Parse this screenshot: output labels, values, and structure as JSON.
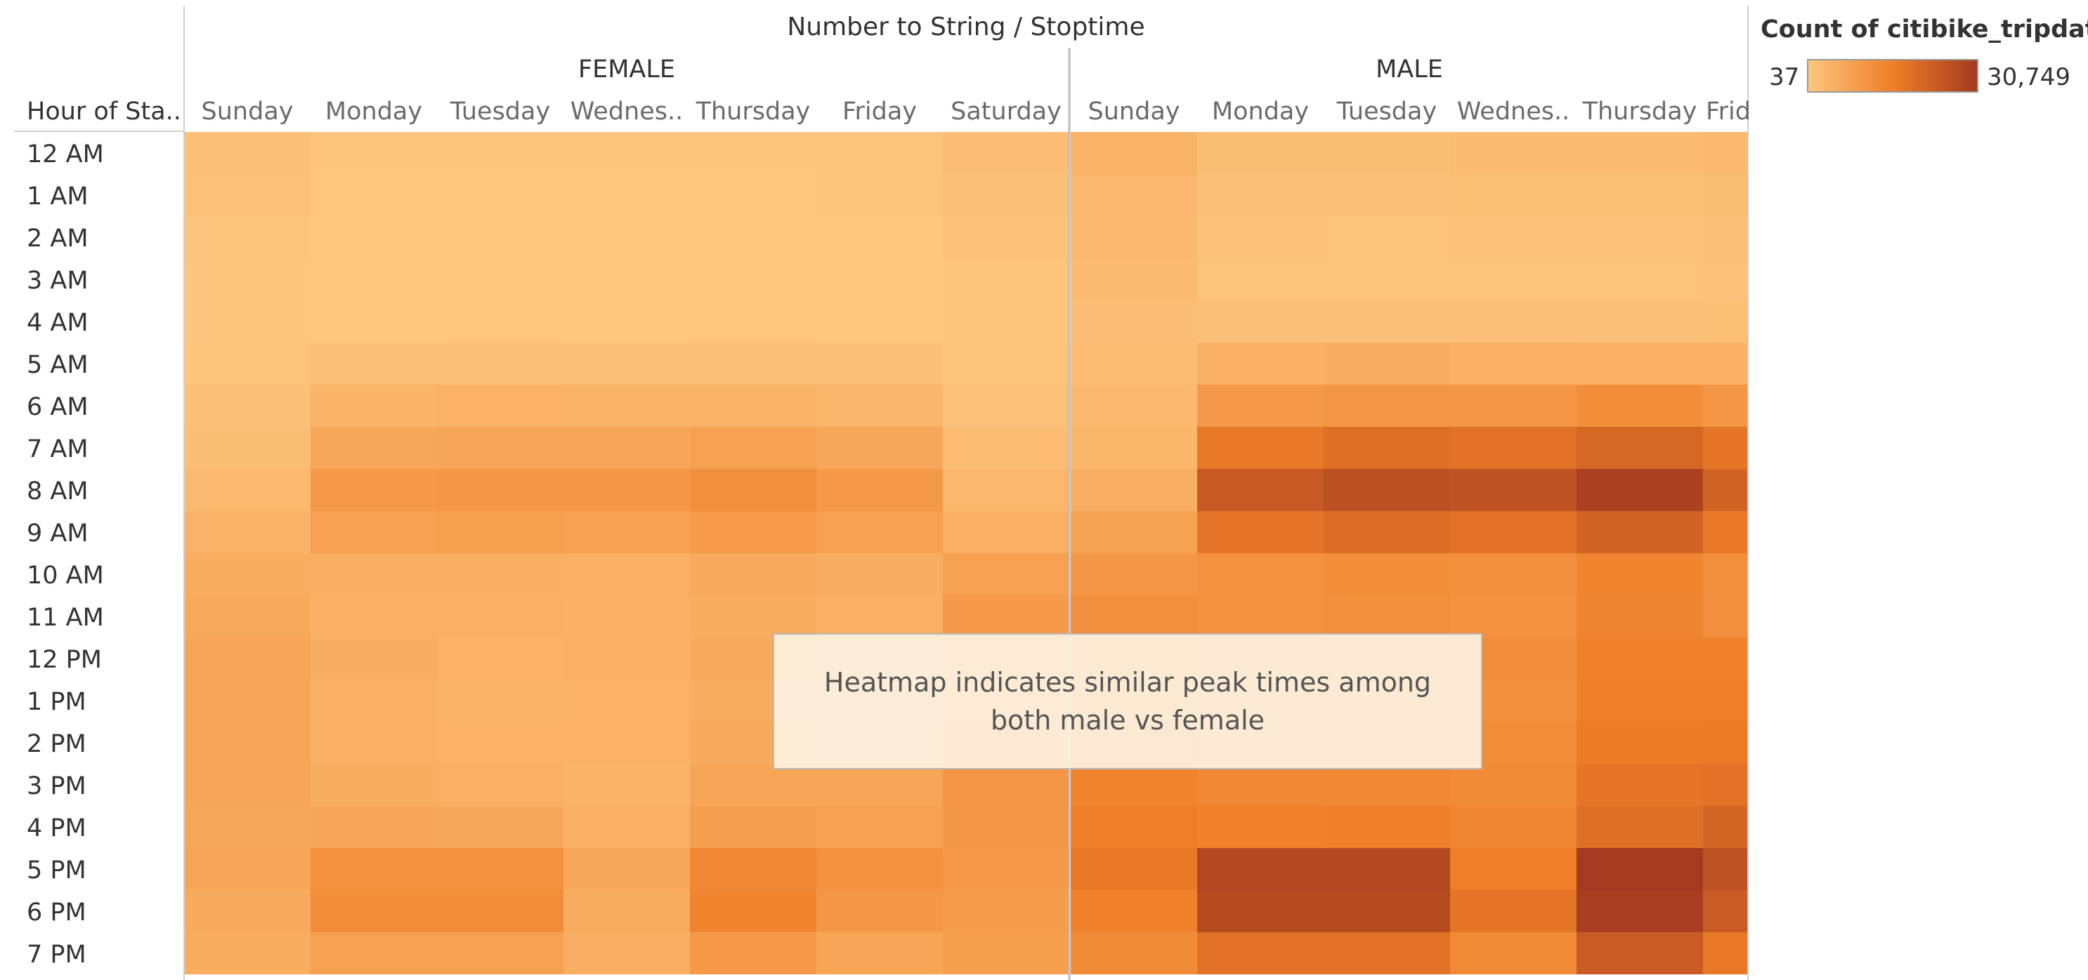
{
  "chart_data": {
    "type": "heatmap",
    "title": "Number to String / Stoptime",
    "row_header": "Hour of Sta..",
    "groups": [
      {
        "name": "FEMALE",
        "columns": [
          "Sunday",
          "Monday",
          "Tuesday",
          "Wednes..",
          "Thursday",
          "Friday",
          "Saturday"
        ]
      },
      {
        "name": "MALE",
        "columns": [
          "Sunday",
          "Monday",
          "Tuesday",
          "Wednes..",
          "Thursday",
          "Frid"
        ]
      }
    ],
    "rows": [
      "12 AM",
      "1 AM",
      "2 AM",
      "3 AM",
      "4 AM",
      "5 AM",
      "6 AM",
      "7 AM",
      "8 AM",
      "9 AM",
      "10 AM",
      "11 AM",
      "12 PM",
      "1 PM",
      "2 PM",
      "3 PM",
      "4 PM",
      "5 PM",
      "6 PM",
      "7 PM"
    ],
    "values": [
      [
        1400,
        600,
        500,
        500,
        600,
        700,
        1800,
        4500,
        2000,
        2000,
        2500,
        2500,
        3000
      ],
      [
        1000,
        300,
        250,
        250,
        300,
        400,
        1300,
        3600,
        1300,
        1200,
        1500,
        1500,
        2000
      ],
      [
        700,
        200,
        150,
        150,
        200,
        250,
        900,
        3000,
        900,
        800,
        900,
        900,
        1300
      ],
      [
        500,
        150,
        120,
        120,
        150,
        200,
        600,
        2500,
        800,
        700,
        800,
        800,
        1100
      ],
      [
        400,
        250,
        200,
        200,
        250,
        300,
        400,
        1800,
        1200,
        1200,
        1400,
        1300,
        1500
      ],
      [
        600,
        1300,
        1400,
        1300,
        1400,
        1200,
        700,
        2200,
        5000,
        5600,
        5300,
        5300,
        5000
      ],
      [
        1200,
        4200,
        4800,
        4600,
        4400,
        3800,
        1100,
        3000,
        10500,
        11500,
        11200,
        13500,
        11000
      ],
      [
        1900,
        7200,
        8000,
        7600,
        9000,
        7200,
        2200,
        3900,
        18000,
        20000,
        19500,
        21500,
        18500
      ],
      [
        2900,
        10500,
        11000,
        11000,
        13000,
        10500,
        3500,
        5500,
        24500,
        26500,
        26000,
        29500,
        22500
      ],
      [
        4300,
        8800,
        9300,
        9000,
        10200,
        8800,
        5300,
        8500,
        19000,
        20500,
        19500,
        22500,
        18000
      ],
      [
        5900,
        5400,
        5400,
        5300,
        6400,
        5600,
        9000,
        11200,
        12500,
        13500,
        13000,
        15500,
        13000
      ],
      [
        6800,
        5100,
        5100,
        5000,
        5900,
        5300,
        10400,
        13000,
        12000,
        13000,
        12300,
        15200,
        13000
      ],
      [
        7500,
        5600,
        4800,
        5000,
        6400,
        5800,
        11500,
        14500,
        12800,
        13600,
        13200,
        16200,
        16000
      ],
      [
        7800,
        5100,
        4500,
        4700,
        6100,
        5600,
        11300,
        14800,
        13000,
        13500,
        13000,
        16500,
        17000
      ],
      [
        7700,
        5300,
        4700,
        4800,
        6500,
        6300,
        11700,
        15000,
        13500,
        14200,
        13600,
        17500,
        17500
      ],
      [
        7600,
        5800,
        5100,
        4200,
        7800,
        7800,
        11200,
        15500,
        14500,
        14600,
        13900,
        18500,
        19500
      ],
      [
        7400,
        7500,
        7000,
        5000,
        9400,
        8700,
        11000,
        17000,
        16000,
        16600,
        15000,
        20000,
        22000
      ],
      [
        7600,
        12500,
        12500,
        7000,
        14500,
        12000,
        10600,
        18000,
        28000,
        28000,
        17000,
        30749,
        26000
      ],
      [
        6400,
        13500,
        13500,
        6100,
        15500,
        11000,
        9900,
        16000,
        27500,
        27500,
        18500,
        30000,
        24000
      ],
      [
        5900,
        8900,
        8900,
        5400,
        10500,
        7800,
        9500,
        14000,
        19500,
        19500,
        14000,
        24000,
        18000
      ]
    ],
    "color_scale": {
      "min": 37,
      "max": 30749,
      "min_color": "#fdc67f",
      "max_color": "#a43b20"
    },
    "legend_position": "top-right",
    "color_legend_title": "Count of citibike_tripdat..",
    "color_legend_min": "37",
    "color_legend_max": "30,749",
    "annotation": "Heatmap indicates similar peak times among both male vs female"
  }
}
